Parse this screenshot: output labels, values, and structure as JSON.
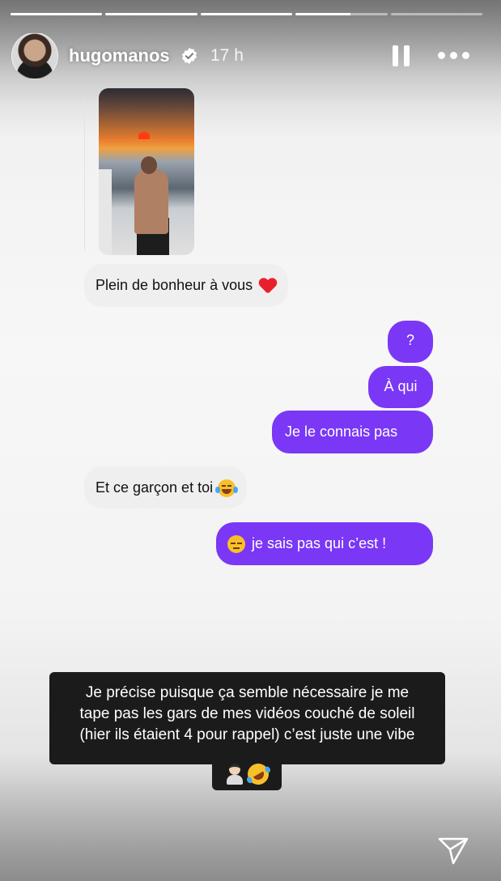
{
  "story": {
    "username": "hugomanos",
    "time": "17 h",
    "progress": [
      1,
      1,
      1,
      0.6,
      0
    ],
    "colors": {
      "outgoing_bubble": "#7a37f5",
      "incoming_bubble": "#efefef",
      "caption_bg": "#1b1b1b"
    }
  },
  "header": {
    "avatar_icon": "avatar",
    "verified_icon": "verified-badge-icon",
    "pause_icon": "pause-icon",
    "more_icon": "more-options-icon"
  },
  "chat": {
    "messages": [
      {
        "side": "incoming",
        "text": "Plein de bonheur à vous",
        "emoji": "red-heart"
      },
      {
        "side": "outgoing",
        "text": "?"
      },
      {
        "side": "outgoing",
        "text": "À qui"
      },
      {
        "side": "outgoing",
        "text": "Je le connais pas"
      },
      {
        "side": "incoming",
        "text": "Et ce garçon et toi",
        "emoji": "face-with-tears-of-joy"
      },
      {
        "side": "outgoing",
        "text": "je sais pas qui c’est !",
        "emoji": "unamused-face"
      }
    ]
  },
  "caption": {
    "lines": [
      "Je précise puisque ça semble nécessaire je me",
      "tape pas les gars de mes vidéos couché de soleil",
      "(hier ils étaient 4 pour rappel) c’est juste une vibe"
    ],
    "emojis": [
      "person-emoji",
      "rolling-on-the-floor-laughing-emoji"
    ]
  },
  "footer": {
    "send_icon": "send-icon"
  }
}
